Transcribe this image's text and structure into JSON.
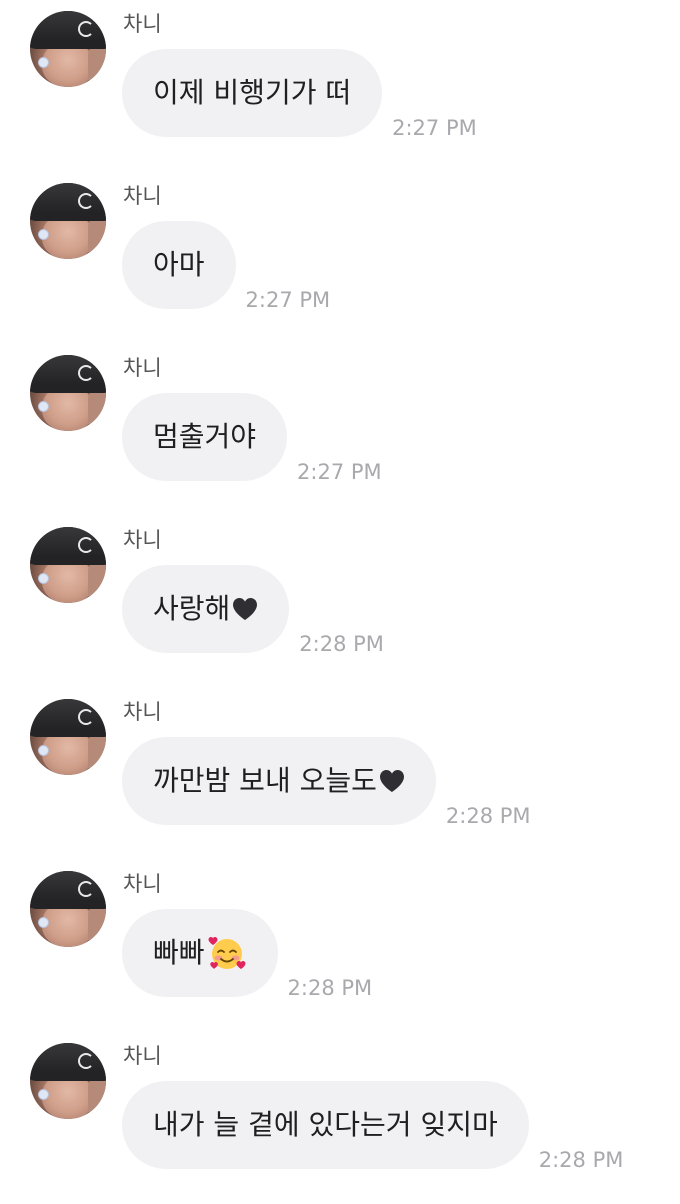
{
  "messages": [
    {
      "sender": "차니",
      "text": "이제 비행기가 떠",
      "time": "2:27 PM"
    },
    {
      "sender": "차니",
      "text": "아마",
      "time": "2:27 PM"
    },
    {
      "sender": "차니",
      "text": "멈출거야",
      "time": "2:27 PM"
    },
    {
      "sender": "차니",
      "text": "사랑해",
      "icon": "black-heart-icon",
      "time": "2:28 PM"
    },
    {
      "sender": "차니",
      "text": "까만밤 보내 오늘도",
      "icon": "black-heart-icon",
      "time": "2:28 PM"
    },
    {
      "sender": "차니",
      "text": "빠빠",
      "icon": "smiling-face-with-hearts-icon",
      "time": "2:28 PM"
    },
    {
      "sender": "차니",
      "text": "내가 늘 곁에 있다는거 잊지마",
      "time": "2:28 PM"
    }
  ],
  "colors": {
    "bubble": "#f1f1f4",
    "time": "#a9a9ad",
    "sender": "#555555",
    "text": "#1f1f1f",
    "heart": "#2f2f33"
  }
}
